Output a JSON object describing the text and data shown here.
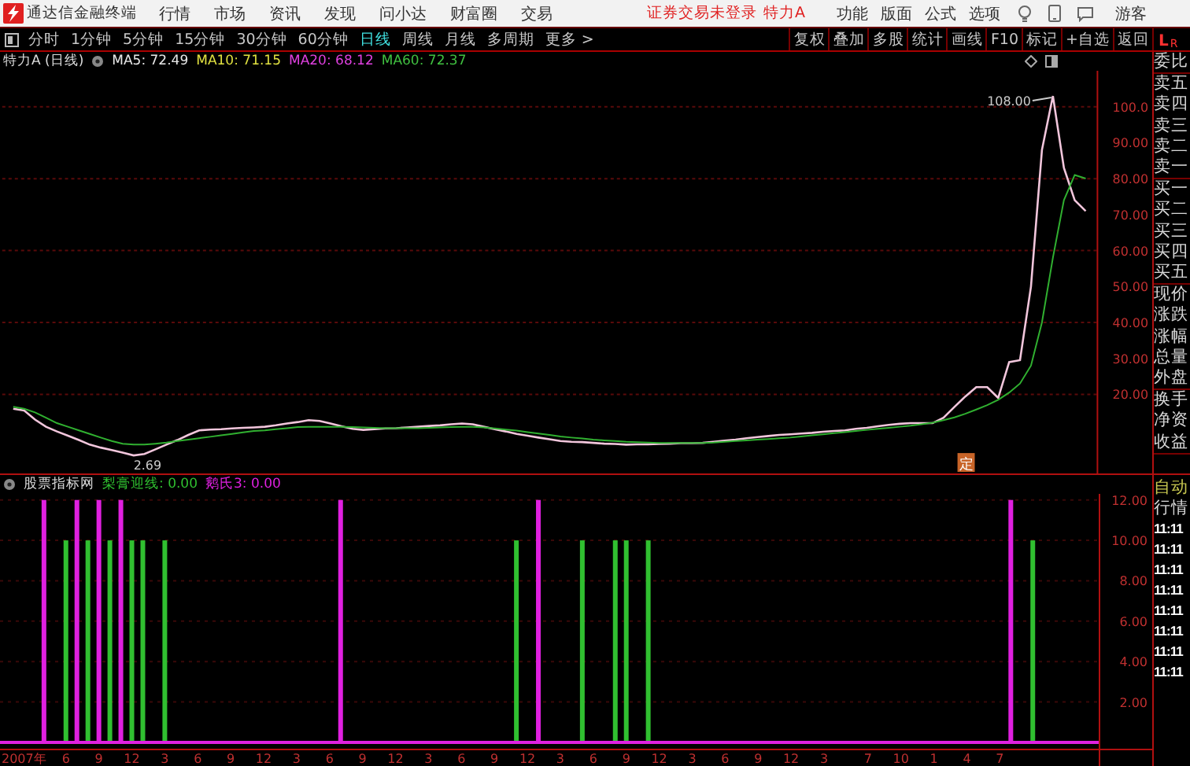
{
  "title_bar": {
    "app_name": "通达信金融终端",
    "menu": [
      "行情",
      "市场",
      "资讯",
      "发现",
      "问小达",
      "财富圈",
      "交易"
    ],
    "login_notice": "证券交易未登录",
    "stock_name": "特力A",
    "tools": [
      "功能",
      "版面",
      "公式",
      "选项"
    ],
    "user": "游客"
  },
  "toolbar": {
    "periods": [
      {
        "label": "分时",
        "selected": false
      },
      {
        "label": "1分钟",
        "selected": false
      },
      {
        "label": "5分钟",
        "selected": false
      },
      {
        "label": "15分钟",
        "selected": false
      },
      {
        "label": "30分钟",
        "selected": false
      },
      {
        "label": "60分钟",
        "selected": false
      },
      {
        "label": "日线",
        "selected": true
      },
      {
        "label": "周线",
        "selected": false
      },
      {
        "label": "月线",
        "selected": false
      },
      {
        "label": "多周期",
        "selected": false
      },
      {
        "label": "更多 >",
        "selected": false
      }
    ],
    "actions": [
      "复权",
      "叠加",
      "多股",
      "统计",
      "画线",
      "F10",
      "标记",
      "+自选",
      "返回"
    ],
    "level_badge": [
      "L",
      "R"
    ]
  },
  "price_panel": {
    "title": "特力A (日线)",
    "legend": [
      {
        "text": "MA5: 72.49",
        "color": "#e8e8e8"
      },
      {
        "text": "MA10: 71.15",
        "color": "#e0e040"
      },
      {
        "text": "MA20: 68.12",
        "color": "#e040e0"
      },
      {
        "text": "MA60: 72.37",
        "color": "#40c040"
      }
    ],
    "chart_data": {
      "type": "line",
      "grid": true,
      "series": [
        {
          "color": "#f2c6dc",
          "values": [
            16,
            15.5,
            13,
            11,
            9.7,
            8.5,
            7.3,
            6,
            5.2,
            4.5,
            3.8,
            3,
            3.4,
            4.7,
            6,
            7.3,
            8.7,
            10,
            10.2,
            10.3,
            10.5,
            10.7,
            10.8,
            11,
            11.4,
            11.9,
            12.3,
            12.8,
            12.6,
            11.9,
            11.1,
            10.4,
            10.1,
            10.3,
            10.5,
            10.6,
            10.8,
            11,
            11.2,
            11.4,
            11.7,
            11.9,
            11.7,
            11,
            10.3,
            9.7,
            9,
            8.5,
            8,
            7.5,
            7,
            6.8,
            6.7,
            6.5,
            6.3,
            6.2,
            6,
            6.1,
            6.1,
            6.2,
            6.3,
            6.4,
            6.4,
            6.5,
            6.8,
            7.1,
            7.4,
            7.8,
            8.1,
            8.4,
            8.7,
            8.9,
            9.1,
            9.3,
            9.6,
            9.8,
            10,
            10.4,
            10.7,
            11.1,
            11.5,
            11.8,
            12,
            12,
            12,
            13.5,
            16.5,
            19.4,
            22,
            22,
            19,
            29,
            29.5,
            50,
            88,
            103,
            83,
            74,
            71
          ]
        },
        {
          "color": "#30b030",
          "values": [
            16.5,
            16,
            15,
            13.5,
            12,
            11,
            10,
            9,
            8,
            7,
            6.3,
            6,
            6,
            6.3,
            6.6,
            7,
            7.4,
            7.8,
            8.2,
            8.6,
            9,
            9.4,
            9.8,
            10,
            10.3,
            10.6,
            10.9,
            11,
            11,
            11,
            11,
            10.9,
            10.8,
            10.7,
            10.6,
            10.6,
            10.6,
            10.6,
            10.7,
            10.8,
            10.9,
            11,
            11,
            10.8,
            10.5,
            10.2,
            9.9,
            9.5,
            9.1,
            8.7,
            8.3,
            8,
            7.7,
            7.4,
            7.2,
            7,
            6.8,
            6.7,
            6.6,
            6.5,
            6.5,
            6.5,
            6.5,
            6.5,
            6.6,
            6.8,
            7,
            7.2,
            7.4,
            7.6,
            7.8,
            8,
            8.3,
            8.6,
            8.9,
            9.2,
            9.5,
            9.8,
            10.1,
            10.4,
            10.7,
            11,
            11.3,
            11.7,
            12.1,
            12.8,
            13.6,
            14.6,
            15.8,
            17,
            18.5,
            20.5,
            23,
            28,
            40,
            58,
            74,
            81,
            80
          ]
        }
      ],
      "ylim": [
        -2,
        110
      ],
      "yticks": [
        {
          "value": 20,
          "label": "20.00"
        },
        {
          "value": 30,
          "label": "30.00"
        },
        {
          "value": 40,
          "label": "40.00"
        },
        {
          "value": 50,
          "label": "50.00"
        },
        {
          "value": 60,
          "label": "60.00"
        },
        {
          "value": 70,
          "label": "70.00"
        },
        {
          "value": 80,
          "label": "80.00"
        },
        {
          "value": 90,
          "label": "90.00"
        },
        {
          "value": 100,
          "label": "100.0"
        }
      ],
      "annotations": [
        "108.00",
        "2.69"
      ]
    },
    "event_badge": "定"
  },
  "indicator_panel": {
    "title": "股票指标网",
    "legend": [
      {
        "text": "梨膏迎线: 0.00",
        "color": "#30c030"
      },
      {
        "text": "鹅氏3: 0.00",
        "color": "#e020e0"
      }
    ],
    "chart_data": {
      "type": "bar",
      "grid": true,
      "categories": [
        "2007年",
        null,
        null,
        null,
        null,
        "6",
        null,
        null,
        "9",
        null,
        null,
        "12",
        null,
        null,
        "3",
        null,
        null,
        "6",
        null,
        null,
        "9",
        null,
        null,
        "12",
        null,
        null,
        "3",
        null,
        null,
        "6",
        null,
        null,
        "9",
        null,
        null,
        "12",
        null,
        null,
        "3",
        null,
        null,
        "6",
        null,
        null,
        "9",
        null,
        null,
        "12",
        null,
        null,
        "3",
        null,
        null,
        "6",
        null,
        null,
        "9",
        null,
        null,
        "12",
        null,
        null,
        "3",
        null,
        null,
        "6",
        null,
        null,
        "9",
        null,
        null,
        "12",
        null,
        null,
        "3",
        null,
        null,
        null,
        "7",
        null,
        null,
        "10",
        null,
        null,
        "1",
        null,
        null,
        "4",
        null,
        null,
        "7",
        null,
        null,
        null,
        null,
        null,
        null,
        null,
        null
      ],
      "series": [
        {
          "color": "#30c030",
          "values": [
            null,
            null,
            null,
            null,
            null,
            10,
            null,
            10,
            null,
            10,
            null,
            10,
            10,
            null,
            10,
            null,
            null,
            null,
            null,
            null,
            null,
            null,
            null,
            null,
            null,
            null,
            null,
            null,
            null,
            null,
            null,
            null,
            null,
            null,
            null,
            null,
            null,
            null,
            null,
            null,
            null,
            null,
            null,
            null,
            null,
            null,
            10,
            null,
            null,
            null,
            null,
            null,
            10,
            null,
            null,
            10,
            10,
            null,
            10,
            null,
            null,
            null,
            null,
            null,
            null,
            null,
            null,
            null,
            null,
            null,
            null,
            null,
            null,
            null,
            null,
            null,
            null,
            null,
            null,
            null,
            null,
            null,
            null,
            null,
            null,
            null,
            null,
            null,
            null,
            null,
            null,
            null,
            null,
            10,
            null,
            null,
            null,
            null,
            null
          ]
        },
        {
          "color": "#e020e0",
          "values": [
            null,
            null,
            null,
            12,
            null,
            null,
            12,
            null,
            12,
            null,
            12,
            null,
            null,
            null,
            null,
            null,
            null,
            null,
            null,
            null,
            null,
            null,
            null,
            null,
            null,
            null,
            null,
            null,
            null,
            null,
            12,
            null,
            null,
            null,
            null,
            null,
            null,
            null,
            null,
            null,
            null,
            null,
            null,
            null,
            null,
            null,
            null,
            null,
            12,
            null,
            null,
            null,
            null,
            null,
            null,
            null,
            null,
            null,
            null,
            null,
            null,
            null,
            null,
            null,
            null,
            null,
            null,
            null,
            null,
            null,
            null,
            null,
            null,
            null,
            null,
            null,
            null,
            null,
            null,
            null,
            null,
            null,
            null,
            null,
            null,
            null,
            null,
            null,
            null,
            null,
            null,
            12,
            null,
            null,
            null,
            null,
            null,
            null,
            null
          ]
        }
      ],
      "ylim": [
        0,
        12.3
      ],
      "yticks": [
        {
          "value": 2,
          "label": "2.00"
        },
        {
          "value": 4,
          "label": "4.00"
        },
        {
          "value": 6,
          "label": "6.00"
        },
        {
          "value": 8,
          "label": "8.00"
        },
        {
          "value": 10,
          "label": "10.00"
        },
        {
          "value": 12,
          "label": "12.00"
        }
      ]
    }
  },
  "quote_panel": {
    "groups": [
      [
        "委比"
      ],
      [
        "卖五",
        "卖四",
        "卖三",
        "卖二",
        "卖一"
      ],
      [
        "买一",
        "买二",
        "买三",
        "买四",
        "买五"
      ],
      [
        "现价",
        "涨跌",
        "涨幅",
        "总量",
        "外盘"
      ],
      [
        "换手",
        "净资",
        "收益"
      ]
    ],
    "status": [
      {
        "kind": "mode",
        "text": "自动"
      },
      {
        "kind": "label",
        "text": "行情"
      }
    ],
    "ticks": [
      "11:11",
      "11:11",
      "11:11",
      "11:11",
      "11:11",
      "11:11",
      "11:11",
      "11:11"
    ]
  }
}
